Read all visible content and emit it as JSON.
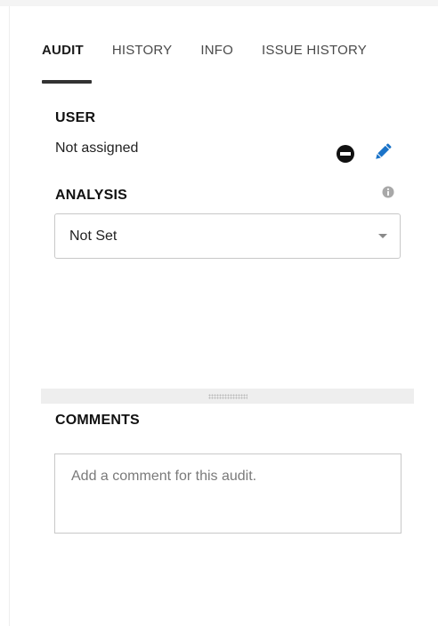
{
  "tabs": [
    {
      "label": "AUDIT",
      "active": true
    },
    {
      "label": "HISTORY",
      "active": false
    },
    {
      "label": "INFO",
      "active": false
    },
    {
      "label": "ISSUE HISTORY",
      "active": false
    }
  ],
  "user": {
    "label": "USER",
    "value": "Not assigned",
    "actions": [
      "remove-icon",
      "pencil-icon"
    ]
  },
  "analysis": {
    "label": "ANALYSIS",
    "info_icon": "info-icon",
    "selected": "Not Set"
  },
  "comments": {
    "label": "COMMENTS",
    "placeholder": "Add a comment for this audit.",
    "value": ""
  },
  "colors": {
    "accent": "#1a73c8",
    "text": "#1f1f1f",
    "border": "#c8c8c8",
    "divider": "#eeeeee"
  }
}
